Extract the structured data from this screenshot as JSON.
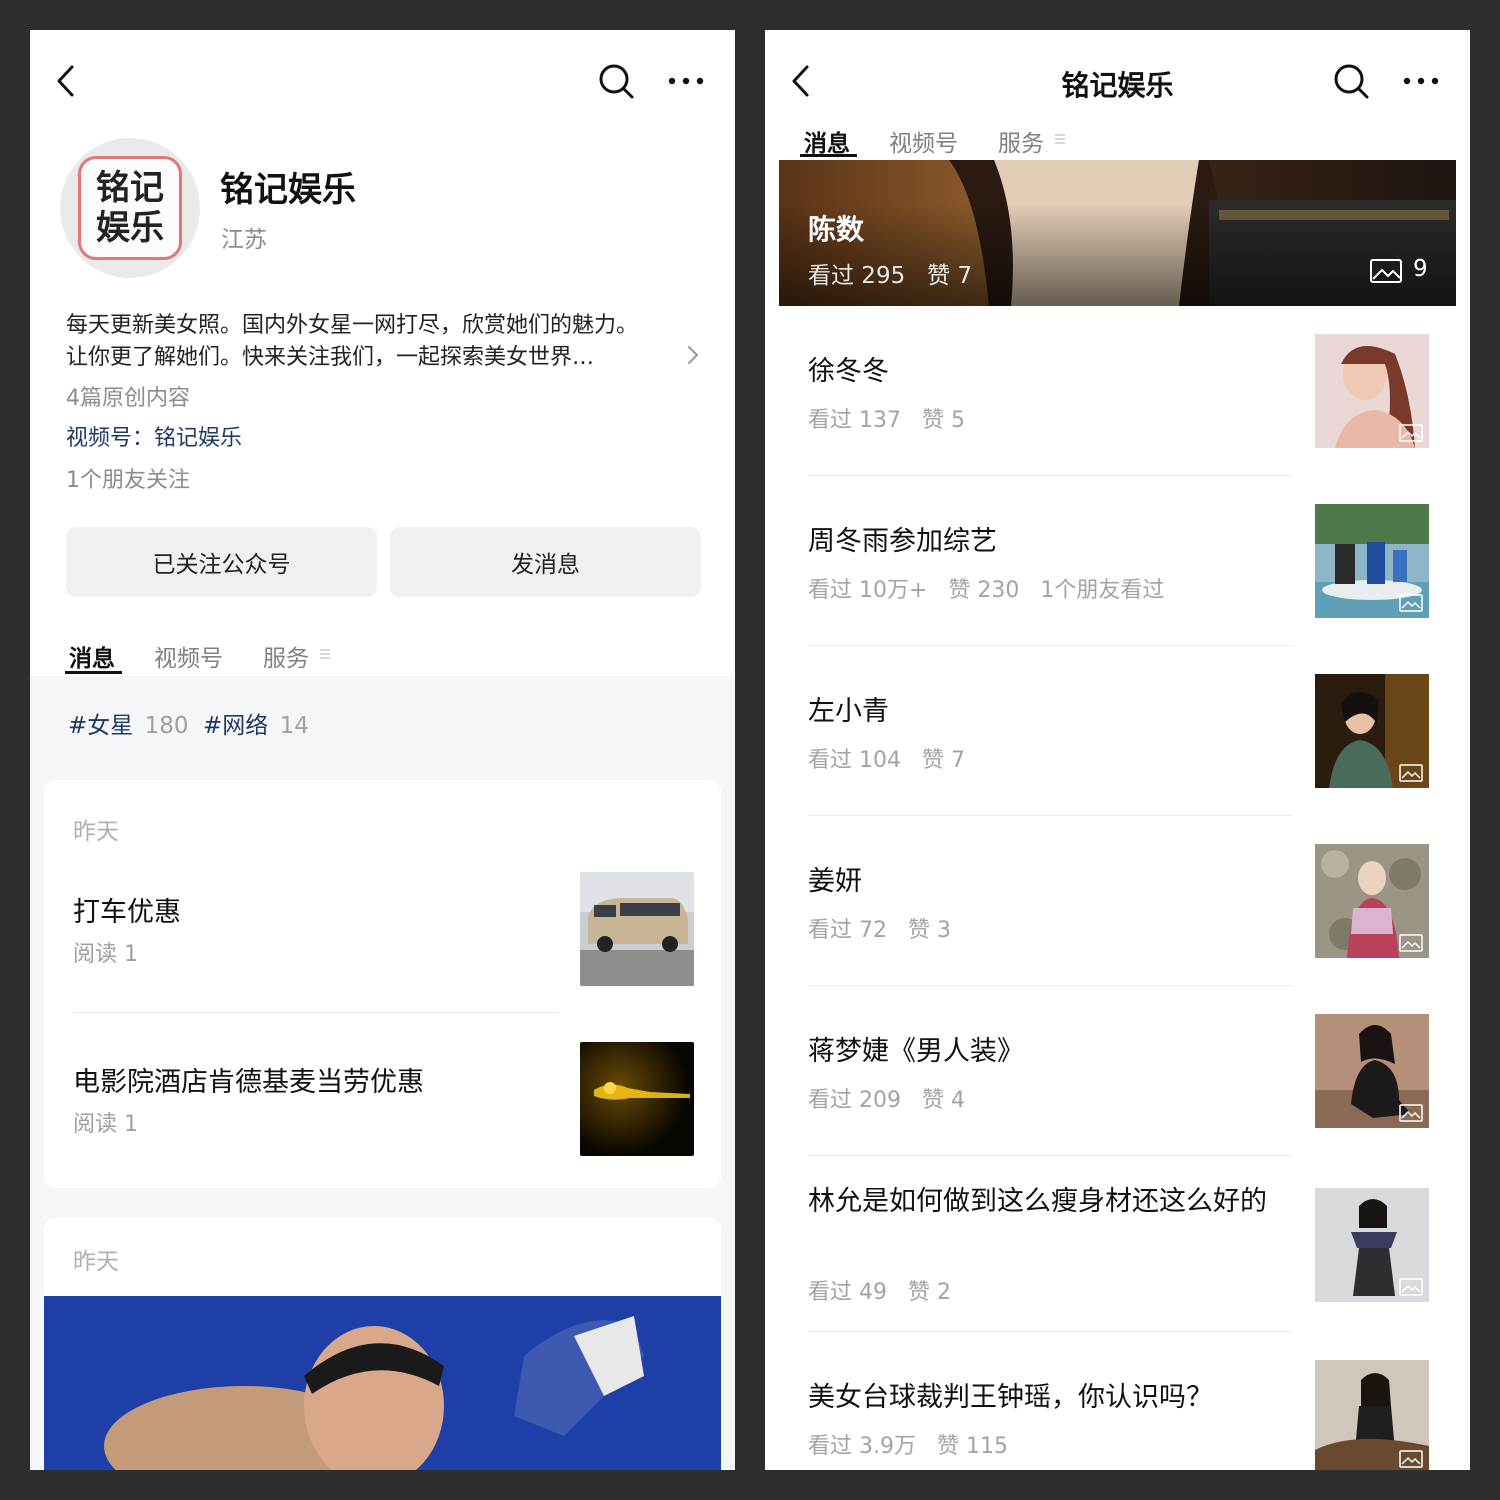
{
  "account": {
    "name": "铭记娱乐",
    "avatar_text": [
      "铭记",
      "娱乐"
    ],
    "region": "江苏",
    "bio_line1": "每天更新美女照。国内外女星一网打尽，欣赏她们的魅力。",
    "bio_line2": "让你更了解她们。快来关注我们，一起探索美女世界…",
    "original_count": "4篇原创内容",
    "channel_label": "视频号：",
    "channel_name": "铭记娱乐",
    "friends_following": "1个朋友关注",
    "followed_button": "已关注公众号",
    "message_button": "发消息"
  },
  "tabs": [
    "消息",
    "视频号",
    "服务"
  ],
  "tags": [
    {
      "name": "#女星",
      "count": "180"
    },
    {
      "name": "#网络",
      "count": "14"
    }
  ],
  "feed": {
    "groups": [
      {
        "date": "昨天",
        "articles": [
          {
            "title": "打车优惠",
            "meta": "阅读 1"
          },
          {
            "title": "电影院酒店肯德基麦当劳优惠",
            "meta": "阅读 1"
          }
        ]
      },
      {
        "date": "昨天"
      }
    ]
  },
  "right": {
    "title": "铭记娱乐",
    "banner": {
      "title": "陈数",
      "meta": "看过 295   赞 7",
      "image_count": "9"
    },
    "rows": [
      {
        "title": "徐冬冬",
        "meta": "看过 137   赞 5"
      },
      {
        "title": "周冬雨参加综艺",
        "meta": "看过 10万+   赞 230   1个朋友看过"
      },
      {
        "title": "左小青",
        "meta": "看过 104   赞 7"
      },
      {
        "title": "姜妍",
        "meta": "看过 72   赞 3"
      },
      {
        "title": "蒋梦婕《男人装》",
        "meta": "看过 209   赞 4"
      },
      {
        "title": "林允是如何做到这么瘦身材还这么好的",
        "meta": "看过 49   赞 2"
      },
      {
        "title": "美女台球裁判王钟瑶，你认识吗？",
        "meta": "看过 3.9万   赞 115"
      }
    ]
  },
  "icons": {
    "back": "chevron-left-icon",
    "search": "search-icon",
    "more": "more-dots-icon",
    "bio_expand": "chevron-right-icon",
    "tab_menu": "menu-lines-icon",
    "image_badge": "image-icon"
  },
  "colors": {
    "link": "#1f3a63",
    "background": "#2e2e2e",
    "card_bg": "#f5f6f7",
    "button_bg": "#f0f0f0"
  }
}
